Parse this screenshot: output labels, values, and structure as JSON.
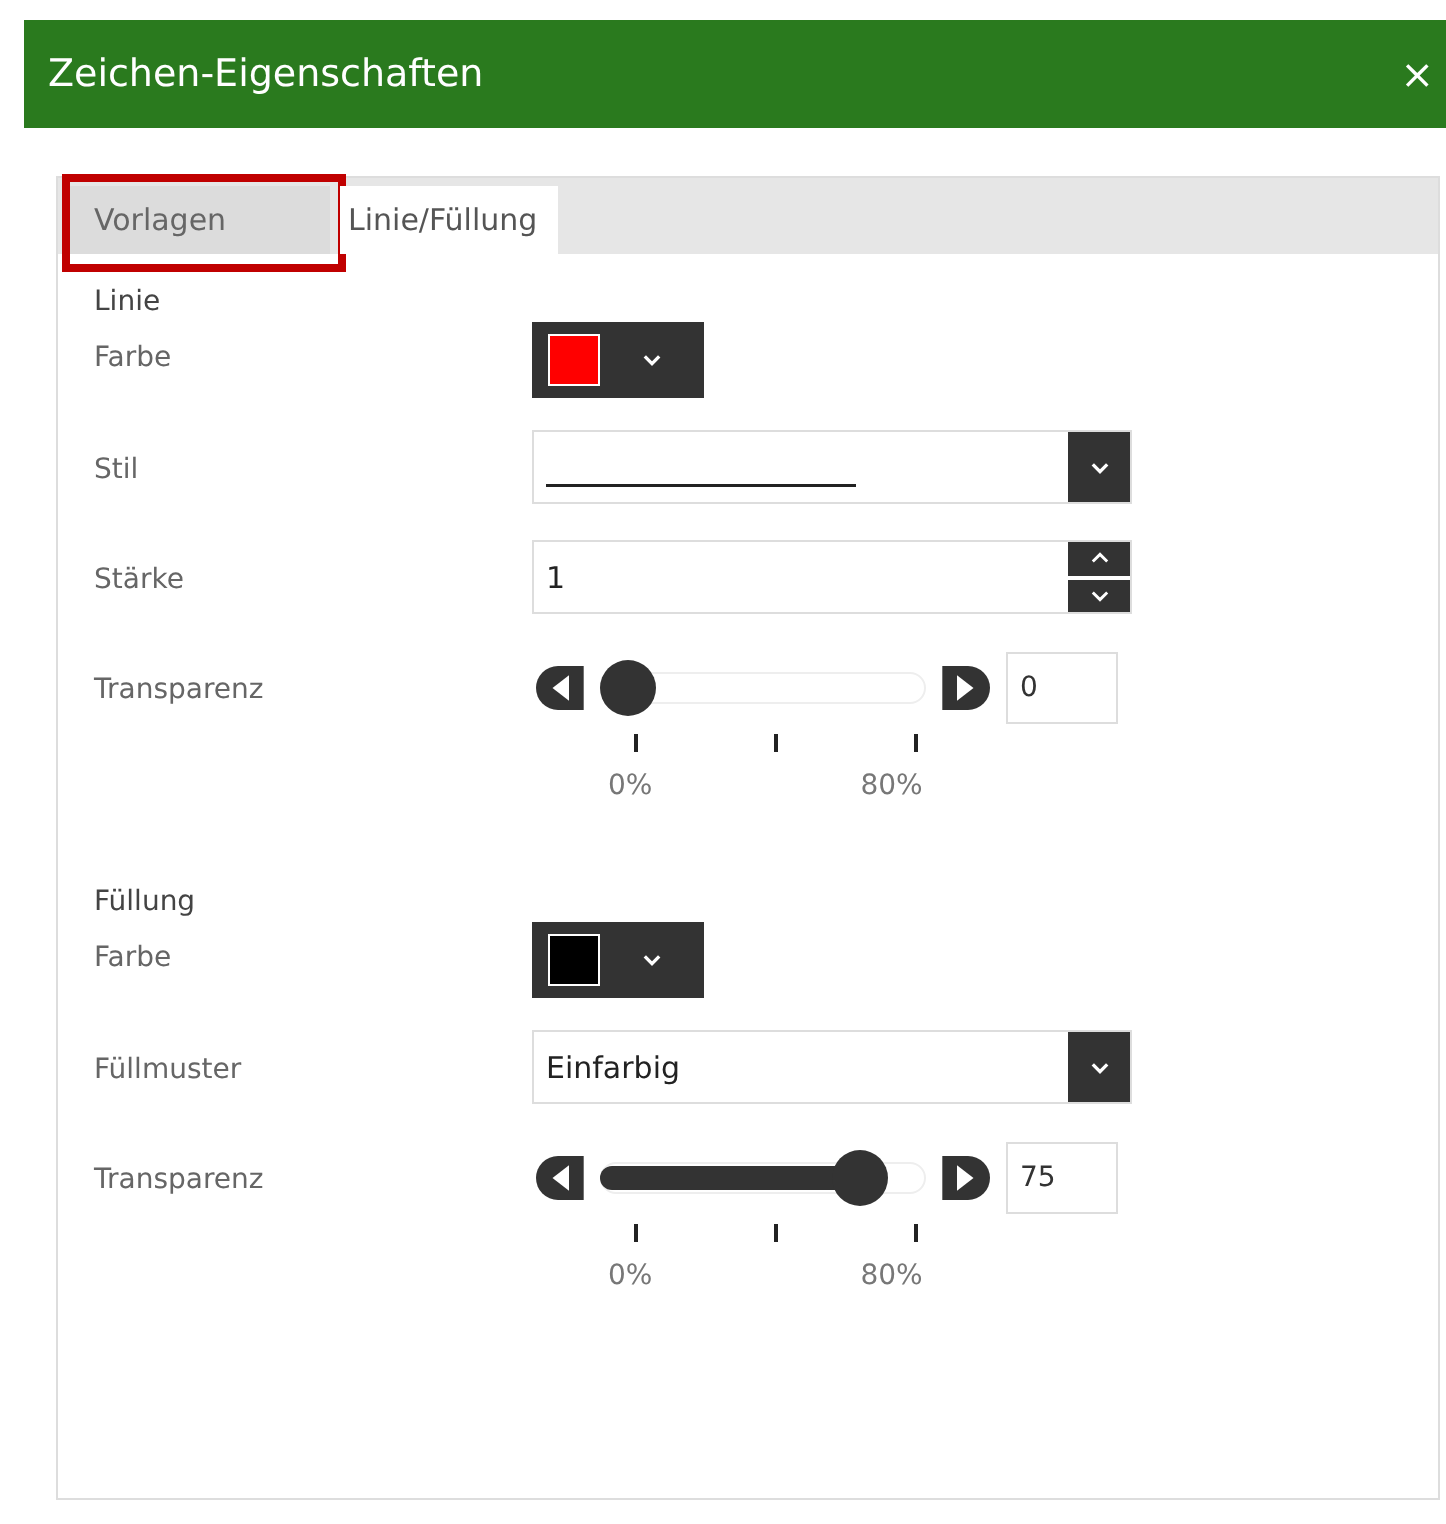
{
  "window": {
    "title": "Zeichen-Eigenschaften",
    "close": "×"
  },
  "tabs": [
    {
      "label": "Vorlagen",
      "selected": false,
      "highlighted": true
    },
    {
      "label": "Linie/Füllung",
      "selected": true,
      "highlighted": false
    }
  ],
  "sections": [
    {
      "title": "Linie",
      "fields": [
        {
          "kind": "color",
          "label": "Farbe",
          "color": "#ff0000"
        },
        {
          "kind": "linestyle",
          "label": "Stil"
        },
        {
          "kind": "number",
          "label": "Stärke",
          "value": "1"
        },
        {
          "kind": "slider",
          "label": "Transparenz",
          "level": 0,
          "value": "0",
          "ticks": [
            "0%",
            "80%"
          ]
        }
      ]
    },
    {
      "title": "Füllung",
      "fields": [
        {
          "kind": "color",
          "label": "Farbe",
          "color": "#000000"
        },
        {
          "kind": "select",
          "label": "Füllmuster",
          "value": "Einfarbig"
        },
        {
          "kind": "slider",
          "label": "Transparenz",
          "level": 0.86,
          "value": "75",
          "ticks": [
            "0%",
            "80%"
          ]
        }
      ]
    }
  ]
}
